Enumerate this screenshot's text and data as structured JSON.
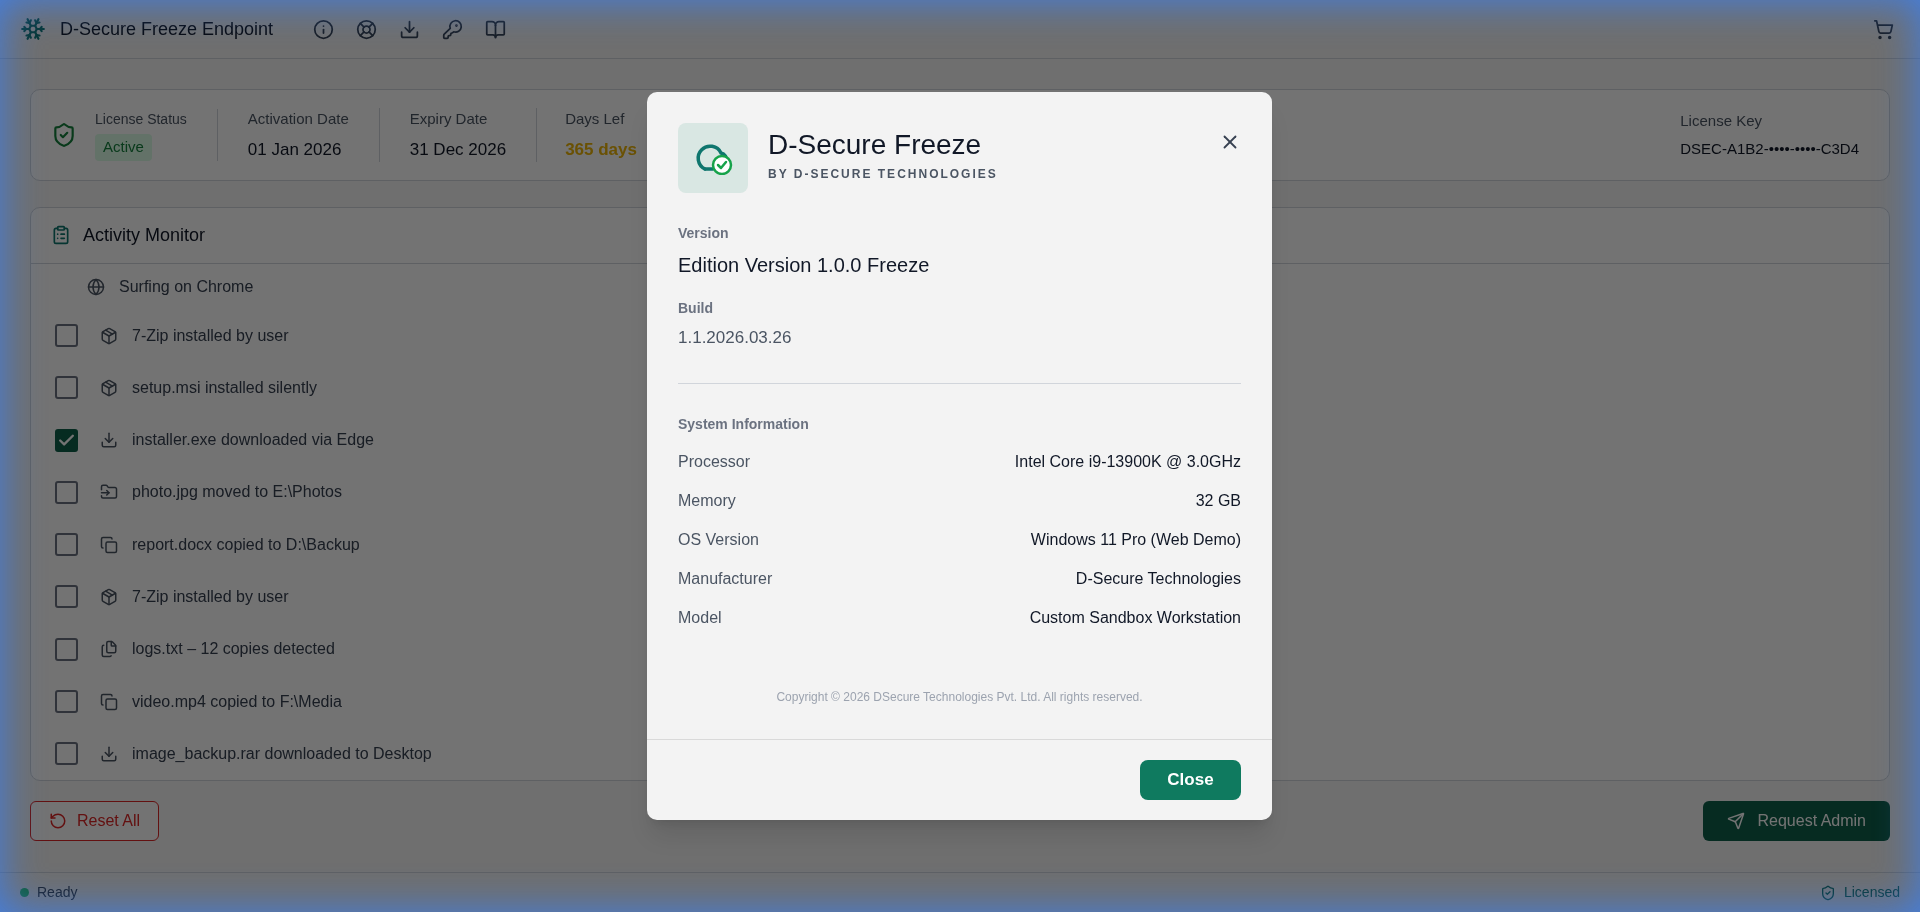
{
  "app": {
    "title": "D-Secure Freeze Endpoint",
    "toolbar": [
      {
        "kind": "info"
      },
      {
        "kind": "help"
      },
      {
        "kind": "download"
      },
      {
        "kind": "key"
      },
      {
        "kind": "docs"
      }
    ]
  },
  "license": {
    "status_label": "License Status",
    "status": "Active",
    "active": true,
    "activation_label": "Activation Date",
    "activation": "01 Jan 2026",
    "expiry_label": "Expiry Date",
    "expiry": "31 Dec 2026",
    "days_label": "Days Lef",
    "days": "365 days",
    "key_label": "License Key",
    "key": "DSEC-A1B2-••••-••••-C3D4"
  },
  "activity_monitor": {
    "title": "Activity Monitor",
    "current": {
      "kind": "browse",
      "text": "Surfing on Chrome"
    },
    "items": [
      {
        "kind": "install",
        "text": "7-Zip installed by user",
        "checked": false
      },
      {
        "kind": "install",
        "text": "setup.msi installed silently",
        "checked": false
      },
      {
        "kind": "download",
        "text": "installer.exe downloaded via Edge",
        "checked": true
      },
      {
        "kind": "move",
        "text": "photo.jpg moved to E:\\Photos",
        "checked": false
      },
      {
        "kind": "copy",
        "text": "report.docx copied to D:\\Backup",
        "checked": false
      },
      {
        "kind": "install",
        "text": "7-Zip installed by user",
        "checked": false
      },
      {
        "kind": "duplicates",
        "text": "logs.txt – 12 copies detected",
        "checked": false
      },
      {
        "kind": "copy",
        "text": "video.mp4 copied to F:\\Media",
        "checked": false
      },
      {
        "kind": "download",
        "text": "image_backup.rar downloaded to Desktop",
        "checked": false
      }
    ]
  },
  "actions": {
    "reset": "Reset All",
    "request": "Request Admin"
  },
  "status_bar": {
    "left": "Ready",
    "ready": true,
    "right": "Licensed"
  },
  "dialog": {
    "title": "D-Secure Freeze",
    "subtitle": "BY D-SECURE TECHNOLOGIES",
    "version_label": "Version",
    "version": "Edition Version 1.0.0 Freeze",
    "build_label": "Build",
    "build": "1.1.2026.03.26",
    "system_title": "System Information",
    "system": [
      {
        "label": "Processor",
        "value": "Intel Core i9-13900K @ 3.0GHz"
      },
      {
        "label": "Memory",
        "value": "32 GB"
      },
      {
        "label": "OS Version",
        "value": "Windows 11 Pro (Web Demo)"
      },
      {
        "label": "Manufacturer",
        "value": "D-Secure Technologies"
      },
      {
        "label": "Model",
        "value": "Custom Sandbox Workstation"
      }
    ],
    "copyright": "Copyright © 2026 DSecure Technologies Pvt. Ltd. All rights reserved.",
    "close": "Close"
  }
}
